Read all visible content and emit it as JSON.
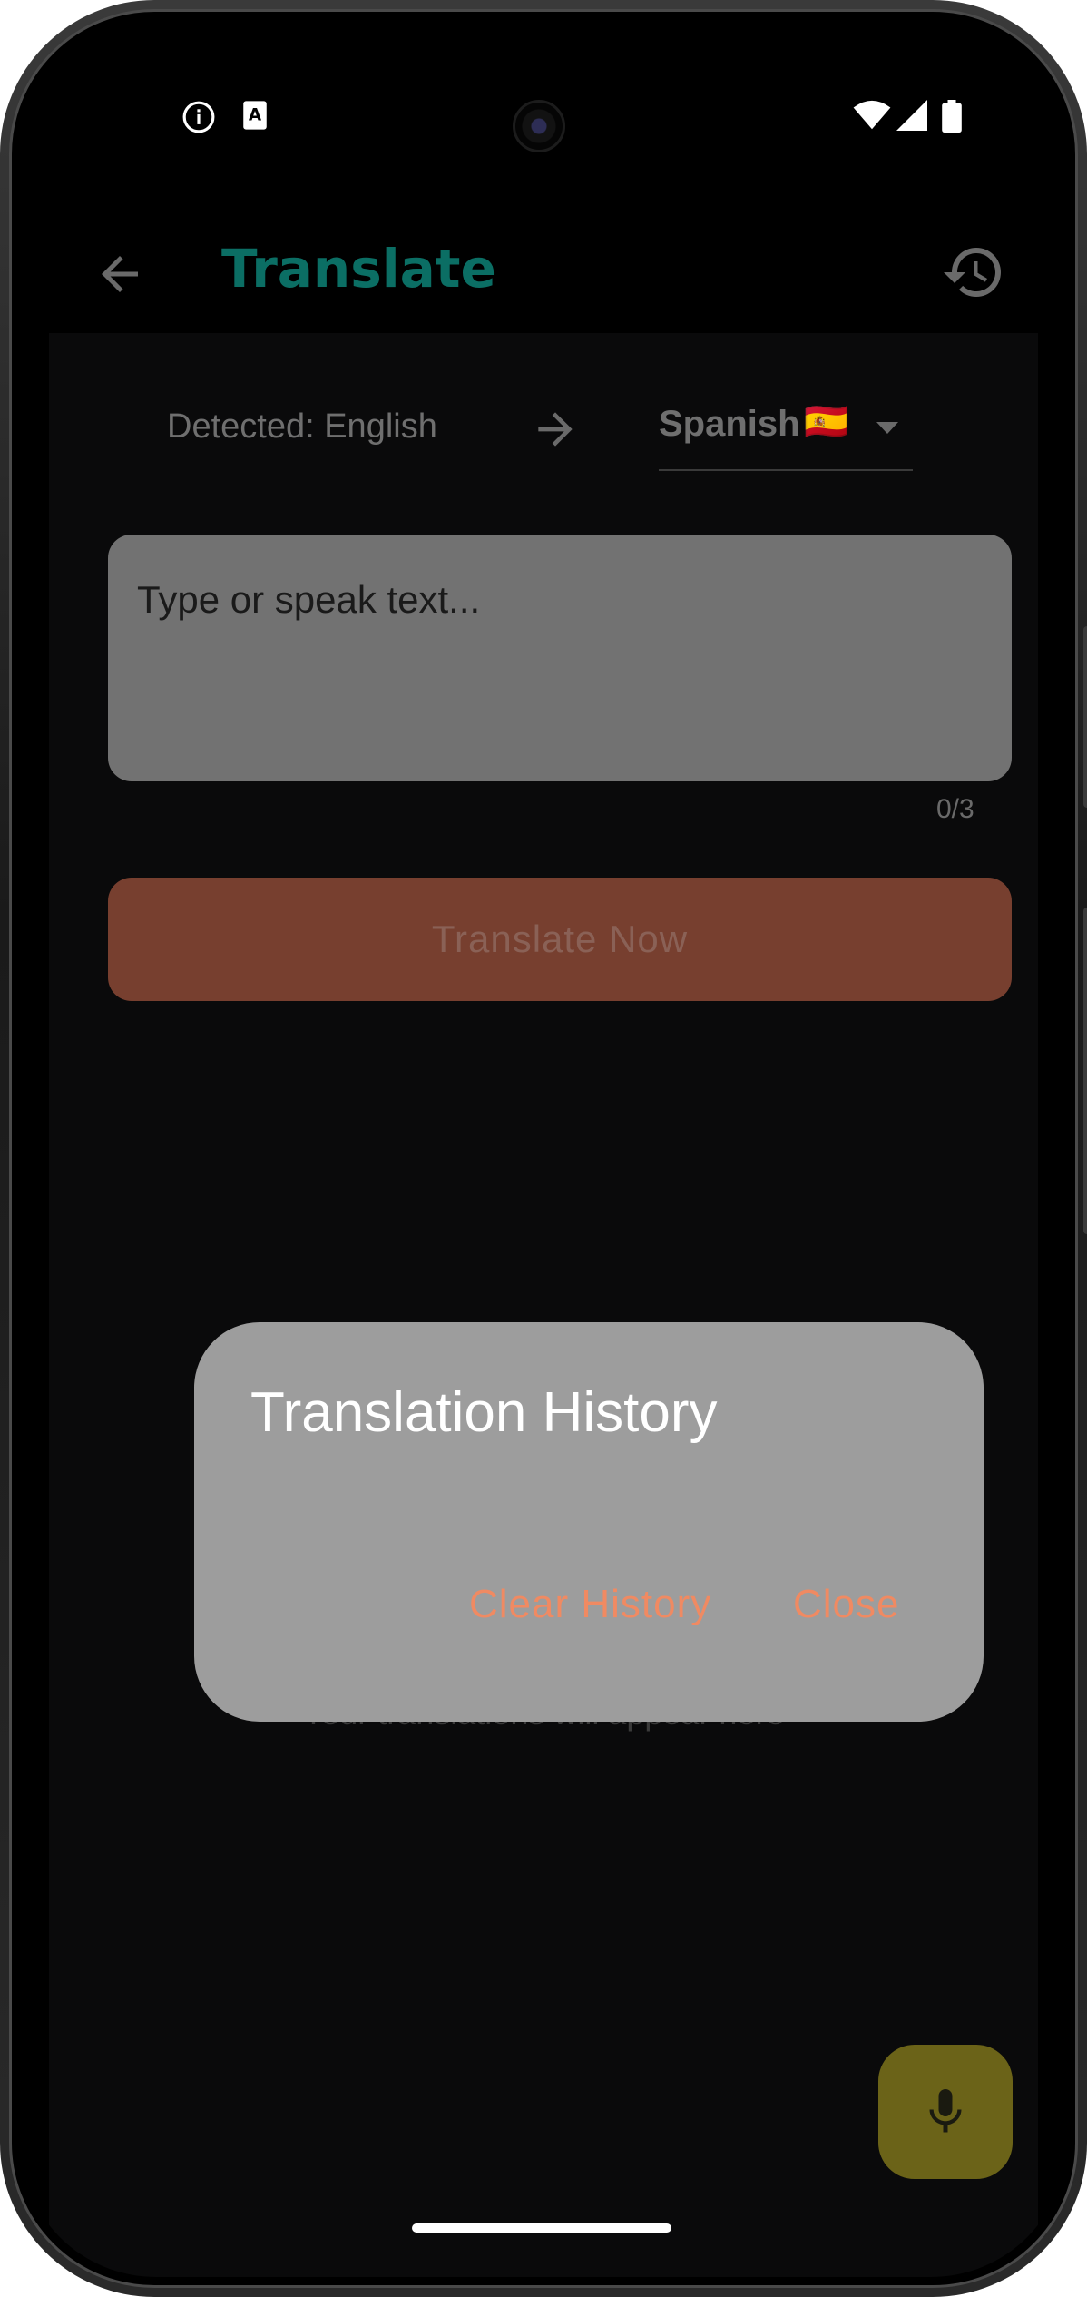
{
  "app_bar": {
    "title": "Translate",
    "back_icon": "arrow-left-icon",
    "history_icon": "history-icon"
  },
  "language_row": {
    "detected_label": "Detected: English",
    "arrow_icon": "arrow-right-icon",
    "target_language": "Spanish",
    "target_flag": "🇪🇸"
  },
  "input": {
    "placeholder": "Type or speak text...",
    "value": "",
    "char_counter": "0/3"
  },
  "translate_button": {
    "label": "Translate Now"
  },
  "empty_state": {
    "icon": "translate-icon",
    "text": "Your translations will appear here"
  },
  "fab": {
    "icon": "microphone-icon"
  },
  "dialog": {
    "title": "Translation History",
    "clear_label": "Clear History",
    "close_label": "Close"
  },
  "colors": {
    "title_accent": "#0b6e64",
    "button_bg": "#773f2f",
    "dialog_bg": "#9d9d9d",
    "dialog_action": "#f08a62",
    "fab_bg": "#6b6318"
  }
}
